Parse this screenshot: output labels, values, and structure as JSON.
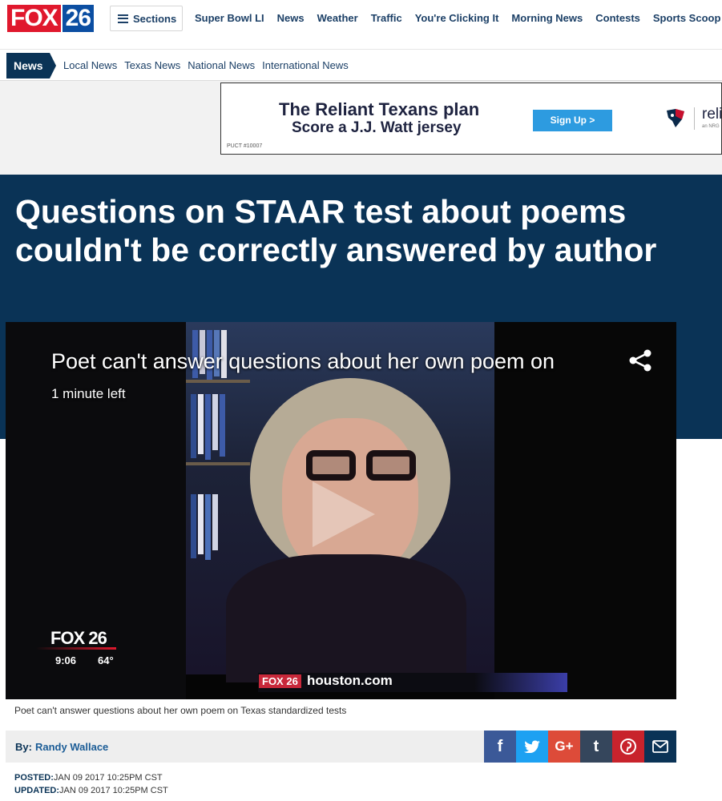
{
  "header": {
    "logo_text_fox": "FOX",
    "logo_text_num": "26",
    "sections_label": "Sections",
    "nav_links": [
      "Super Bowl LI",
      "News",
      "Weather",
      "Traffic",
      "You're Clicking It",
      "Morning News",
      "Contests",
      "Sports Scoop"
    ]
  },
  "subnav": {
    "tag": "News",
    "links": [
      "Local News",
      "Texas News",
      "National News",
      "International News"
    ]
  },
  "ad": {
    "line1": "The Reliant Texans plan",
    "line2": "Score a J.J. Watt jersey",
    "button": "Sign Up >",
    "pucct": "PUCT #10007",
    "brand": "reli",
    "brand_sub": "an NRG"
  },
  "article": {
    "headline": "Questions on STAAR test about poems couldn't be correctly answered by author",
    "caption": "Poet can't answer questions about her own poem on Texas standardized tests",
    "byline_prefix": "By:",
    "author": "Randy Wallace",
    "posted_label": "POSTED:",
    "posted": "JAN 09 2017 10:25PM CST",
    "updated_label": "UPDATED:",
    "updated": "JAN 09 2017 10:25PM CST"
  },
  "video": {
    "title": "Poet can't answer questions about her own poem on",
    "time_left": "1 minute left",
    "bug_logo": "FOX 26",
    "bug_time": "9:06",
    "bug_temp": "64°",
    "lower_fox": "FOX 26",
    "lower_site": "houston.com"
  },
  "social": {
    "facebook": "f",
    "googleplus": "G+",
    "tumblr": "t"
  },
  "colors": {
    "brand_navy": "#0a3356",
    "fox_red": "#e0182d",
    "fox_blue": "#0b4ea2"
  }
}
